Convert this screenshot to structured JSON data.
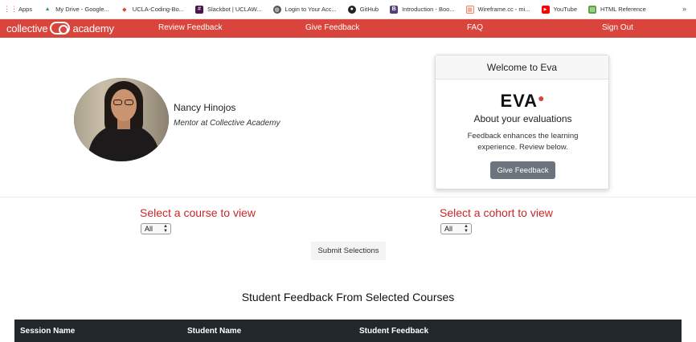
{
  "bookmarks": [
    {
      "label": "Apps",
      "icon": "apps-grid-icon",
      "color": "#e8554e"
    },
    {
      "label": "My Drive - Google...",
      "icon": "google-drive-icon",
      "color": "#1ea362"
    },
    {
      "label": "UCLA-Coding-Bo...",
      "icon": "gitlab-icon",
      "color": "#e24329"
    },
    {
      "label": "Slackbot | UCLAW...",
      "icon": "slack-icon",
      "color": "#4a154b"
    },
    {
      "label": "Login to Your Acc...",
      "icon": "globe-icon",
      "color": "#555555"
    },
    {
      "label": "GitHub",
      "icon": "github-icon",
      "color": "#222222"
    },
    {
      "label": "Introduction - Boo...",
      "icon": "bootstrap-icon",
      "color": "#563d7c"
    },
    {
      "label": "Wireframe.cc - mi...",
      "icon": "wireframe-icon",
      "color": "#f07f5a"
    },
    {
      "label": "YouTube",
      "icon": "youtube-icon",
      "color": "#ff0000"
    },
    {
      "label": "HTML Reference",
      "icon": "html-reference-icon",
      "color": "#59a83f"
    }
  ],
  "bookmarks_more": "»",
  "nav": {
    "brand_left": "collective",
    "brand_right": "academy",
    "links": [
      "Review Feedback",
      "Give Feedback",
      "FAQ",
      "Sign Out"
    ],
    "color": "#d9443d"
  },
  "profile": {
    "name": "Nancy Hinojos",
    "role": "Mentor at Collective Academy"
  },
  "welcome_card": {
    "header": "Welcome to Eva",
    "logo": "EVA",
    "title": "About your evaluations",
    "text": "Feedback enhances the learning experience. Review below.",
    "button": "Give Feedback"
  },
  "selectors": {
    "course_label": "Select a course to view",
    "course_value": "All",
    "cohort_label": "Select a cohort to view",
    "cohort_value": "All",
    "submit": "Submit Selections",
    "label_color": "#c62828"
  },
  "table": {
    "title": "Student Feedback From Selected Courses",
    "columns": [
      "Session Name",
      "Student Name",
      "Student Feedback"
    ]
  }
}
